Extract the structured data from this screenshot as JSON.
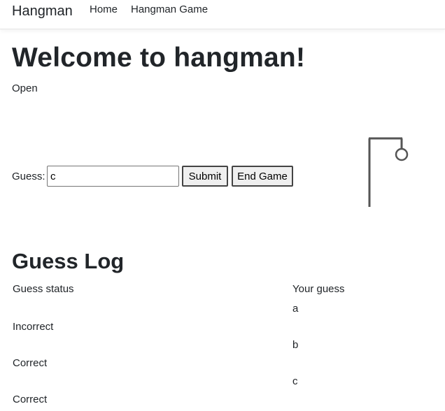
{
  "nav": {
    "brand": "Hangman",
    "links": [
      "Home",
      "Hangman Game"
    ]
  },
  "main": {
    "title": "Welcome to hangman!",
    "status": "Open",
    "guess_label": "Guess:",
    "guess_value": "c",
    "submit_label": "Submit",
    "end_label": "End Game"
  },
  "log": {
    "title": "Guess Log",
    "headers": {
      "status": "Guess status",
      "guess": "Your guess"
    },
    "rows": [
      {
        "guess": "a",
        "status": "Incorrect"
      },
      {
        "guess": "b",
        "status": "Correct"
      },
      {
        "guess": "c",
        "status": "Correct"
      }
    ]
  },
  "hangman": {
    "wrong_guesses": 1,
    "stroke_color": "#555555"
  }
}
